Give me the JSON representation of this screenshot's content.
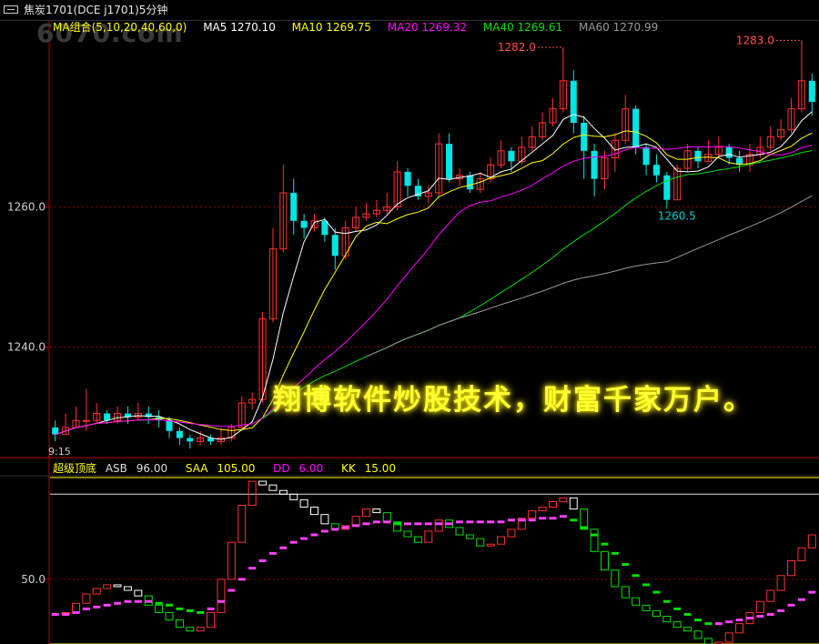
{
  "header": {
    "title": "焦炭1701(DCE j1701)5分钟"
  },
  "watermark": "6070.com",
  "ma_legend": {
    "group": "MA组合(5,10,20,40,60,0)",
    "items": [
      {
        "label": "MA5 1270.10",
        "color": "#ffffff"
      },
      {
        "label": "MA10 1269.75",
        "color": "#ffff00"
      },
      {
        "label": "MA20 1269.32",
        "color": "#ff00ff"
      },
      {
        "label": "MA40 1269.61",
        "color": "#00e000"
      },
      {
        "label": "MA60 1270.99",
        "color": "#999999"
      }
    ]
  },
  "indicator_legend": {
    "name": "超级顶底",
    "items": [
      {
        "key": "ASB",
        "value": "96.00",
        "key_color": "#dddddd",
        "val_color": "#dddddd"
      },
      {
        "key": "SAA",
        "value": "105.00",
        "key_color": "#ffff00",
        "val_color": "#ffff00"
      },
      {
        "key": "DD",
        "value": "6.00",
        "key_color": "#ff00ff",
        "val_color": "#ff00ff"
      },
      {
        "key": "KK",
        "value": "15.00",
        "key_color": "#ffff00",
        "val_color": "#ffff00"
      }
    ]
  },
  "overlay_text": "翔博软件炒股技术，财富千家万户。",
  "colors": {
    "up": "#ff3030",
    "down": "#00e5e5",
    "axis": "#b00000",
    "grid": "#8b0000",
    "price_axis_text": "#d0d0d0"
  },
  "chart_data": [
    {
      "type": "candlestick",
      "title": "焦炭1701(DCE j1701)5分钟",
      "y_ticks": [
        "1260.0",
        "1240.0"
      ],
      "y_tick_values": [
        1260,
        1240
      ],
      "ylim": [
        1224.6,
        1284.6
      ],
      "annotations": [
        {
          "label": "1282.0",
          "index": 49,
          "value": 1282.0,
          "kind": "high"
        },
        {
          "label": "1283.0",
          "index": 72,
          "value": 1283.0,
          "kind": "high"
        },
        {
          "label": "1260.5",
          "index": 59,
          "value": 1260.5,
          "kind": "low"
        }
      ],
      "bottom_label": "9:15",
      "candles": [
        [
          1228.5,
          1227.5,
          1229.5,
          1226.5
        ],
        [
          1227.5,
          1228.5,
          1230.5,
          1227.5
        ],
        [
          1228.5,
          1229.5,
          1231.5,
          1228.5
        ],
        [
          1229.5,
          1229.5,
          1234.0,
          1228.0
        ],
        [
          1229.5,
          1230.5,
          1232.0,
          1229.0
        ],
        [
          1230.5,
          1229.5,
          1231.0,
          1229.0
        ],
        [
          1229.5,
          1230.5,
          1231.5,
          1229.0
        ],
        [
          1230.5,
          1230.0,
          1231.5,
          1229.0
        ],
        [
          1230.0,
          1230.5,
          1232.0,
          1229.5
        ],
        [
          1230.5,
          1230.0,
          1231.5,
          1229.0
        ],
        [
          1230.0,
          1229.5,
          1231.0,
          1228.5
        ],
        [
          1229.5,
          1228.0,
          1230.0,
          1227.0
        ],
        [
          1228.0,
          1227.0,
          1228.5,
          1226.0
        ],
        [
          1227.0,
          1226.5,
          1227.5,
          1225.5
        ],
        [
          1226.5,
          1227.0,
          1228.0,
          1226.0
        ],
        [
          1227.0,
          1226.5,
          1227.5,
          1226.0
        ],
        [
          1226.5,
          1227.0,
          1228.5,
          1226.0
        ],
        [
          1227.0,
          1228.5,
          1229.0,
          1226.5
        ],
        [
          1228.5,
          1232.0,
          1233.0,
          1228.0
        ],
        [
          1232.0,
          1232.5,
          1233.5,
          1231.0
        ],
        [
          1232.5,
          1244.0,
          1245.0,
          1232.0
        ],
        [
          1244.0,
          1254.0,
          1257.0,
          1243.5
        ],
        [
          1254.0,
          1262.0,
          1266.0,
          1253.5
        ],
        [
          1262.0,
          1258.0,
          1264.0,
          1256.0
        ],
        [
          1258.0,
          1257.0,
          1259.0,
          1255.5
        ],
        [
          1257.0,
          1258.0,
          1259.0,
          1256.5
        ],
        [
          1258.0,
          1256.0,
          1258.5,
          1255.0
        ],
        [
          1256.0,
          1253.0,
          1257.0,
          1251.0
        ],
        [
          1253.0,
          1257.0,
          1258.0,
          1252.5
        ],
        [
          1257.0,
          1258.5,
          1260.0,
          1256.5
        ],
        [
          1258.5,
          1259.0,
          1260.5,
          1258.0
        ],
        [
          1259.0,
          1259.5,
          1261.0,
          1258.5
        ],
        [
          1259.5,
          1260.0,
          1262.0,
          1259.0
        ],
        [
          1260.0,
          1265.0,
          1266.5,
          1259.5
        ],
        [
          1265.0,
          1263.0,
          1265.5,
          1261.5
        ],
        [
          1263.0,
          1261.5,
          1264.0,
          1261.0
        ],
        [
          1261.5,
          1262.0,
          1263.0,
          1260.5
        ],
        [
          1262.0,
          1269.0,
          1270.5,
          1261.5
        ],
        [
          1269.0,
          1264.0,
          1270.5,
          1263.5
        ],
        [
          1264.0,
          1264.5,
          1265.5,
          1263.0
        ],
        [
          1264.5,
          1262.5,
          1265.0,
          1262.0
        ],
        [
          1262.5,
          1264.0,
          1265.0,
          1262.0
        ],
        [
          1264.0,
          1266.0,
          1267.0,
          1263.5
        ],
        [
          1266.0,
          1268.0,
          1269.5,
          1265.5
        ],
        [
          1268.0,
          1266.5,
          1268.5,
          1265.0
        ],
        [
          1266.5,
          1268.5,
          1270.0,
          1266.0
        ],
        [
          1268.5,
          1270.0,
          1271.5,
          1268.0
        ],
        [
          1270.0,
          1272.0,
          1273.5,
          1269.5
        ],
        [
          1272.0,
          1274.0,
          1275.5,
          1271.5
        ],
        [
          1274.0,
          1278.0,
          1282.0,
          1273.5
        ],
        [
          1278.0,
          1272.0,
          1279.5,
          1270.5
        ],
        [
          1272.0,
          1268.0,
          1273.0,
          1264.0
        ],
        [
          1268.0,
          1264.0,
          1269.0,
          1261.5
        ],
        [
          1264.0,
          1267.0,
          1268.0,
          1262.5
        ],
        [
          1267.0,
          1269.5,
          1270.5,
          1265.0
        ],
        [
          1269.5,
          1274.0,
          1276.0,
          1269.0
        ],
        [
          1274.0,
          1268.5,
          1274.5,
          1267.5
        ],
        [
          1268.5,
          1266.0,
          1269.0,
          1264.5
        ],
        [
          1266.0,
          1264.5,
          1267.5,
          1263.5
        ],
        [
          1264.5,
          1261.0,
          1265.0,
          1260.5
        ],
        [
          1261.0,
          1265.5,
          1266.0,
          1261.0
        ],
        [
          1265.5,
          1268.0,
          1269.0,
          1265.0
        ],
        [
          1268.0,
          1266.5,
          1268.5,
          1265.5
        ],
        [
          1266.5,
          1267.5,
          1269.5,
          1266.5
        ],
        [
          1267.5,
          1268.5,
          1270.0,
          1267.0
        ],
        [
          1268.5,
          1267.0,
          1269.0,
          1266.0
        ],
        [
          1267.0,
          1266.0,
          1268.0,
          1265.0
        ],
        [
          1266.0,
          1267.5,
          1269.0,
          1265.0
        ],
        [
          1267.5,
          1268.5,
          1270.0,
          1267.0
        ],
        [
          1268.5,
          1270.0,
          1271.5,
          1268.0
        ],
        [
          1270.0,
          1271.0,
          1272.5,
          1269.5
        ],
        [
          1271.0,
          1274.0,
          1275.5,
          1270.5
        ],
        [
          1274.0,
          1278.0,
          1283.0,
          1273.5
        ],
        [
          1278.0,
          1275.0,
          1279.0,
          1273.0
        ]
      ],
      "ma_last": {
        "MA5": 1270.1,
        "MA10": 1269.75,
        "MA20": 1269.32,
        "MA40": 1269.61,
        "MA60": 1270.99
      }
    },
    {
      "type": "indicator",
      "name": "超级顶底",
      "y_ticks": [
        "50.0"
      ],
      "y_tick_values": [
        50
      ],
      "ylim": [
        15,
        105
      ],
      "reference_lines": [
        {
          "name": "SAA",
          "value": 105.0,
          "color": "#ffff00"
        },
        {
          "name": "ASB",
          "value": 96.0,
          "color": "#dddddd"
        },
        {
          "name": "KK",
          "value": 15.0,
          "color": "#ffff00"
        }
      ],
      "fast": [
        31,
        32,
        37,
        42,
        45,
        47,
        46,
        44,
        41,
        36,
        32,
        28,
        24,
        22,
        24,
        32,
        50,
        70,
        90,
        103,
        101,
        98,
        96,
        93,
        89,
        85,
        80,
        77,
        79,
        84,
        88,
        86,
        81,
        76,
        73,
        70,
        76,
        82,
        78,
        74,
        72,
        68,
        69,
        73,
        77,
        83,
        87,
        89,
        92,
        94,
        88,
        77,
        65,
        55,
        46,
        40,
        36,
        33,
        30,
        27,
        24,
        22,
        18,
        15,
        16,
        21,
        26,
        32,
        38,
        44,
        52,
        60,
        67,
        74
      ],
      "slow": [
        31,
        31,
        32,
        34,
        35,
        36,
        37,
        38,
        38,
        38,
        37,
        36,
        34,
        33,
        32,
        34,
        38,
        44,
        50,
        56,
        60,
        64,
        67,
        70,
        72,
        74,
        76,
        77,
        78,
        79,
        80,
        81,
        81,
        80,
        80,
        80,
        80,
        80,
        80,
        81,
        81,
        81,
        81,
        81,
        82,
        82,
        82,
        83,
        83,
        84,
        82,
        78,
        74,
        69,
        64,
        58,
        52,
        47,
        43,
        38,
        34,
        31,
        28,
        26,
        26,
        27,
        28,
        29,
        30,
        31,
        33,
        36,
        39,
        43
      ]
    }
  ]
}
